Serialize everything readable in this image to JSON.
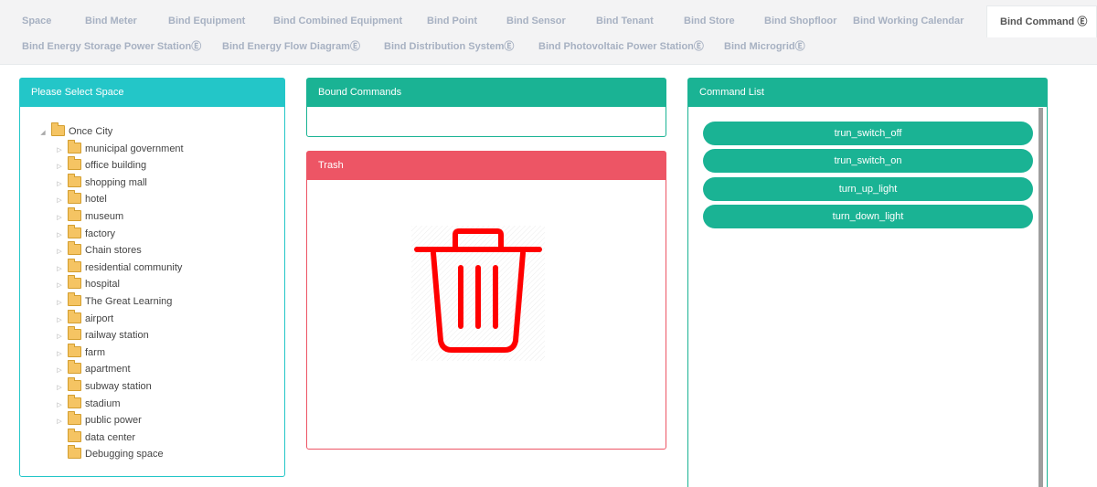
{
  "tabs": {
    "row1": [
      "Space",
      "Bind Meter",
      "Bind Equipment",
      "Bind Combined Equipment",
      "Bind Point",
      "Bind Sensor",
      "Bind Tenant",
      "Bind Store",
      "Bind Shopfloor",
      "Bind Working Calendar",
      "Bind Command Ⓔ"
    ],
    "row2": [
      "Bind Energy Storage Power StationⒺ",
      "Bind Energy Flow DiagramⒺ",
      "Bind Distribution SystemⒺ",
      "Bind Photovoltaic Power StationⒺ",
      "Bind MicrogridⒺ"
    ]
  },
  "space_panel": {
    "title": "Please Select Space",
    "root": "Once City",
    "children": [
      "municipal government",
      "office building",
      "shopping mall",
      "hotel",
      "museum",
      "factory",
      "Chain stores",
      "residential community",
      "hospital",
      "The Great Learning",
      "airport",
      "railway station",
      "farm",
      "apartment",
      "subway station",
      "stadium",
      "public power",
      "data center",
      "Debugging space"
    ]
  },
  "bound_panel": {
    "title": "Bound Commands"
  },
  "trash_panel": {
    "title": "Trash"
  },
  "command_panel": {
    "title": "Command List",
    "commands": [
      "trun_switch_off",
      "trun_switch_on",
      "turn_up_light",
      "turn_down_light"
    ]
  },
  "colors": {
    "teal": "#1ab394",
    "cyan": "#23c6c8",
    "red": "#ed5565",
    "trash_icon": "#ff0000"
  }
}
